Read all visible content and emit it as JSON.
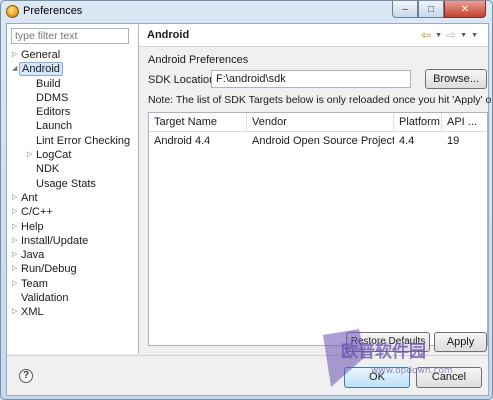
{
  "window": {
    "title": "Preferences"
  },
  "filter": {
    "placeholder": "type filter text"
  },
  "tree": [
    {
      "label": "General",
      "depth": 0,
      "twisty": "collapsed",
      "selected": false
    },
    {
      "label": "Android",
      "depth": 0,
      "twisty": "expanded",
      "selected": true
    },
    {
      "label": "Build",
      "depth": 1,
      "twisty": "none",
      "selected": false
    },
    {
      "label": "DDMS",
      "depth": 1,
      "twisty": "none",
      "selected": false
    },
    {
      "label": "Editors",
      "depth": 1,
      "twisty": "none",
      "selected": false
    },
    {
      "label": "Launch",
      "depth": 1,
      "twisty": "none",
      "selected": false
    },
    {
      "label": "Lint Error Checking",
      "depth": 1,
      "twisty": "none",
      "selected": false
    },
    {
      "label": "LogCat",
      "depth": 1,
      "twisty": "collapsed",
      "selected": false
    },
    {
      "label": "NDK",
      "depth": 1,
      "twisty": "none",
      "selected": false
    },
    {
      "label": "Usage Stats",
      "depth": 1,
      "twisty": "none",
      "selected": false
    },
    {
      "label": "Ant",
      "depth": 0,
      "twisty": "collapsed",
      "selected": false
    },
    {
      "label": "C/C++",
      "depth": 0,
      "twisty": "collapsed",
      "selected": false
    },
    {
      "label": "Help",
      "depth": 0,
      "twisty": "collapsed",
      "selected": false
    },
    {
      "label": "Install/Update",
      "depth": 0,
      "twisty": "collapsed",
      "selected": false
    },
    {
      "label": "Java",
      "depth": 0,
      "twisty": "collapsed",
      "selected": false
    },
    {
      "label": "Run/Debug",
      "depth": 0,
      "twisty": "collapsed",
      "selected": false
    },
    {
      "label": "Team",
      "depth": 0,
      "twisty": "collapsed",
      "selected": false
    },
    {
      "label": "Validation",
      "depth": 0,
      "twisty": "none",
      "selected": false
    },
    {
      "label": "XML",
      "depth": 0,
      "twisty": "collapsed",
      "selected": false
    }
  ],
  "page": {
    "title": "Android",
    "subtitle": "Android Preferences",
    "sdk_label": "SDK Location:",
    "sdk_value": "F:\\android\\sdk",
    "browse_label": "Browse...",
    "note": "Note: The list of SDK Targets below is only reloaded once you hit 'Apply' or 'OK'.",
    "table": {
      "headers": [
        "Target Name",
        "Vendor",
        "Platform",
        "API ..."
      ],
      "rows": [
        [
          "Android 4.4",
          "Android Open Source Project",
          "4.4",
          "19"
        ]
      ]
    },
    "restore_label": "Restore Defaults",
    "apply_label": "Apply"
  },
  "footer": {
    "ok_label": "OK",
    "cancel_label": "Cancel",
    "help_glyph": "?"
  },
  "watermark": {
    "text": "欧普软件园",
    "url": "www.opdown.com"
  },
  "colors": {
    "selection": "#d7e7fa",
    "accent": "#c98a0d",
    "watermark": "#6a4fb0"
  }
}
